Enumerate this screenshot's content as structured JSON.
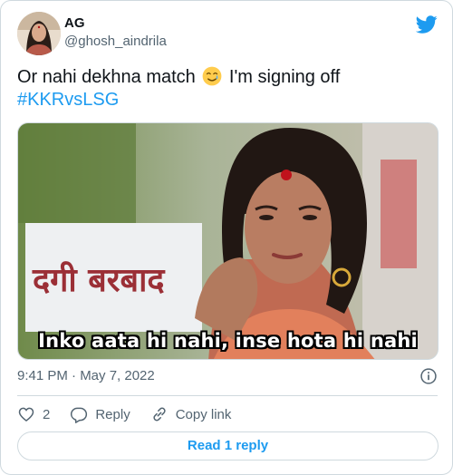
{
  "author": {
    "display_name": "AG",
    "handle": "@ghosh_aindrila"
  },
  "tweet": {
    "text_before_emoji": "Or nahi dekhna match",
    "emoji_name": "smiling-face-with-tear",
    "text_after_emoji": "I'm signing off",
    "hashtag": "#KKRvsLSG"
  },
  "media": {
    "caption": "Inko aata hi nahi, inse hota hi nahi",
    "sign_text": "दगी बरबाद"
  },
  "meta": {
    "timestamp": "9:41 PM · May 7, 2022"
  },
  "actions": {
    "like_count": "2",
    "reply_label": "Reply",
    "copy_link_label": "Copy link"
  },
  "read_replies_label": "Read 1 reply",
  "colors": {
    "accent": "#1d9bf0",
    "secondary_text": "#536471",
    "border": "#cfd9de"
  }
}
